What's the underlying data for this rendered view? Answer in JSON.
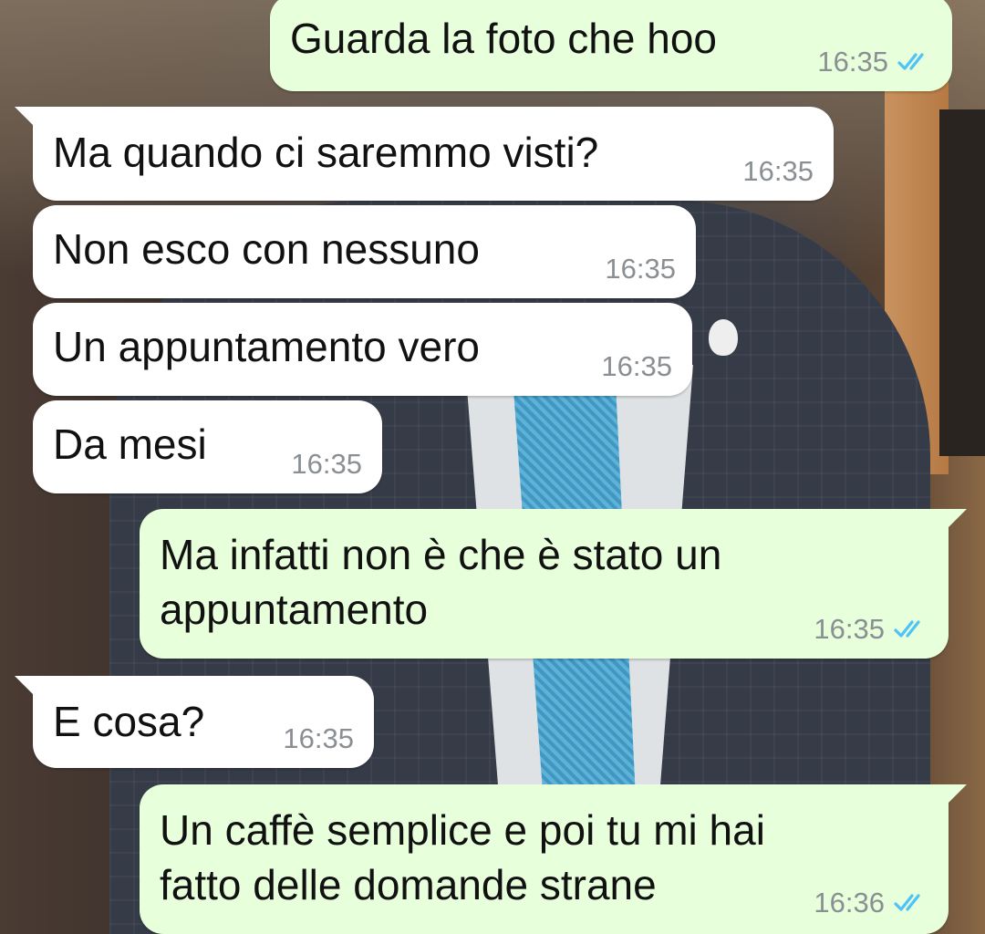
{
  "colors": {
    "outgoing_bubble": "#e7ffdb",
    "incoming_bubble": "#ffffff",
    "read_tick": "#4fc3f7",
    "timestamp": "#8a8f93"
  },
  "messages": [
    {
      "direction": "out",
      "text": "Guarda la foto che hoo",
      "time": "16:35",
      "status_icon": "double-check-read-icon"
    },
    {
      "direction": "in",
      "text": "Ma quando ci saremmo visti?",
      "time": "16:35"
    },
    {
      "direction": "in",
      "text": "Non esco con nessuno",
      "time": "16:35"
    },
    {
      "direction": "in",
      "text": "Un appuntamento vero",
      "time": "16:35"
    },
    {
      "direction": "in",
      "text": "Da mesi",
      "time": "16:35"
    },
    {
      "direction": "out",
      "text": "Ma infatti non è che è stato un\nappuntamento",
      "time": "16:35",
      "status_icon": "double-check-read-icon"
    },
    {
      "direction": "in",
      "text": "E cosa?",
      "time": "16:35"
    },
    {
      "direction": "out",
      "text": "Un caffè semplice e poi tu mi hai\nfatto delle domande strane",
      "time": "16:36",
      "status_icon": "double-check-read-icon"
    }
  ]
}
